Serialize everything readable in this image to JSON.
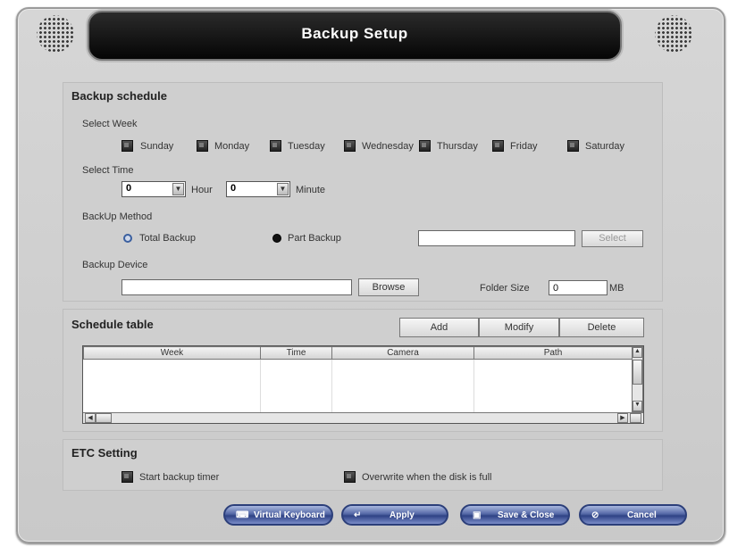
{
  "window": {
    "title": "Backup Setup"
  },
  "schedule": {
    "section_title": "Backup schedule",
    "select_week_label": "Select Week",
    "days": [
      "Sunday",
      "Monday",
      "Tuesday",
      "Wednesday",
      "Thursday",
      "Friday",
      "Saturday"
    ],
    "select_time_label": "Select Time",
    "hour_value": "0",
    "hour_label": "Hour",
    "minute_value": "0",
    "minute_label": "Minute",
    "method_label": "BackUp Method",
    "total_backup": "Total Backup",
    "part_backup": "Part Backup",
    "part_value": "",
    "select_button": "Select",
    "device_label": "Backup Device",
    "device_value": "",
    "browse_button": "Browse",
    "folder_size_label": "Folder Size",
    "folder_size_value": "0",
    "folder_size_unit": "MB"
  },
  "table": {
    "section_title": "Schedule table",
    "add_button": "Add",
    "modify_button": "Modify",
    "delete_button": "Delete",
    "columns": [
      "Week",
      "Time",
      "Camera",
      "Path"
    ]
  },
  "etc": {
    "section_title": "ETC Setting",
    "start_timer": "Start backup timer",
    "overwrite": "Overwrite when the disk is full"
  },
  "footer": {
    "virtual_keyboard": "Virtual Keyboard",
    "apply": "Apply",
    "save_close": "Save & Close",
    "cancel": "Cancel"
  }
}
